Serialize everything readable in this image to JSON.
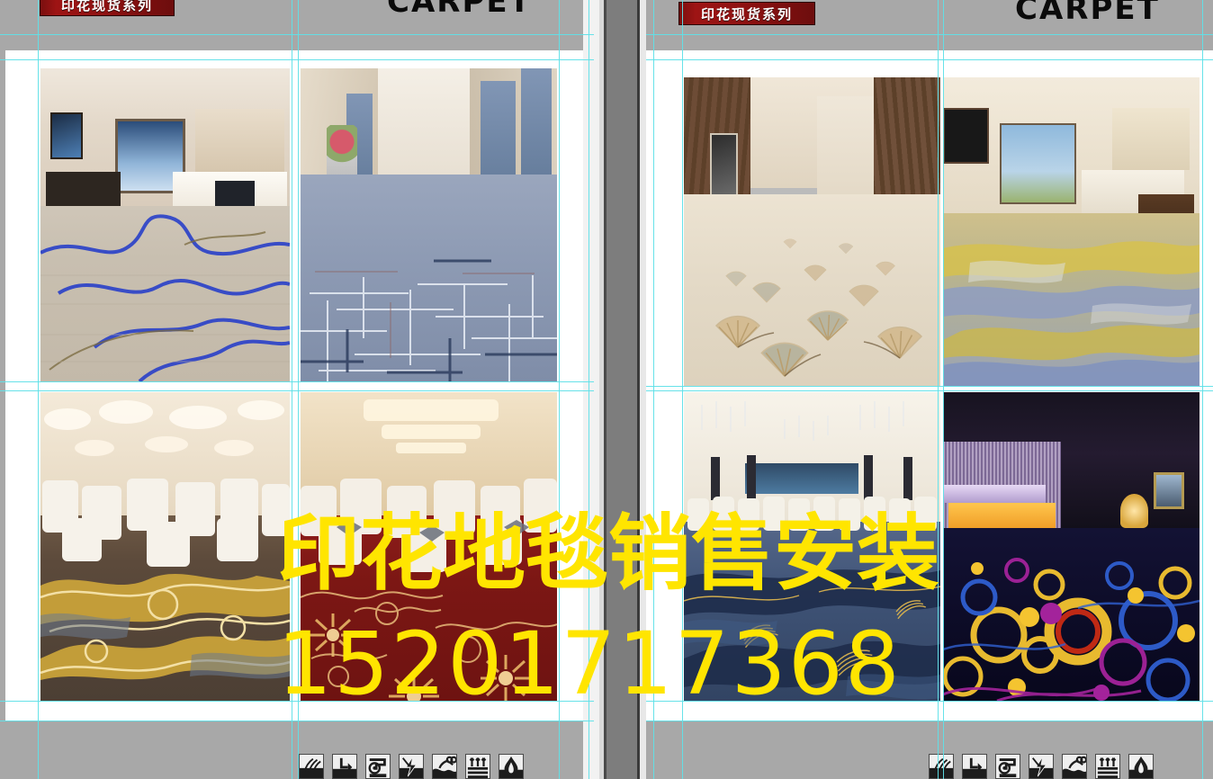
{
  "document": {
    "background_color": "#a8a8a8",
    "guide_color": "#5fe0e8",
    "page_color": "#ffffff",
    "spine_color": "#7d7d7d"
  },
  "watermark": {
    "line1": "印花地毯销售安装",
    "line2": "15201717368",
    "color": "#ffe500"
  },
  "pages": [
    {
      "id": "left",
      "banner": {
        "text": "印花现货系列",
        "bg_color": "#8d1111",
        "text_color": "#ffffff"
      },
      "wordmark": {
        "text": "CARPET",
        "color": "#0b0b0b"
      },
      "photos": [
        {
          "id": "p1",
          "caption": "hotel-bedroom-beige-blue-swirl-carpet"
        },
        {
          "id": "p2",
          "caption": "hotel-corridor-blue-grid-carpet"
        },
        {
          "id": "p3",
          "caption": "banquet-hall-gold-brown-swirl-carpet"
        },
        {
          "id": "p4",
          "caption": "banquet-hall-red-floral-carpet"
        }
      ],
      "icons": [
        {
          "name": "anti-static-icon",
          "label": "anti-static"
        },
        {
          "name": "water-drain-icon",
          "label": "water-drain"
        },
        {
          "name": "vacuum-clean-icon",
          "label": "vacuum-clean"
        },
        {
          "name": "electrical-safe-icon",
          "label": "electrical-safe"
        },
        {
          "name": "stain-resistant-icon",
          "label": "stain-resistant"
        },
        {
          "name": "underfloor-heat-icon",
          "label": "underfloor-heating"
        },
        {
          "name": "flame-retardant-icon",
          "label": "flame-retardant"
        }
      ]
    },
    {
      "id": "right",
      "banner": {
        "text": "印花现货系列",
        "bg_color": "#8d1111",
        "text_color": "#ffffff"
      },
      "wordmark": {
        "text": "CARPET",
        "color": "#0b0b0b"
      },
      "photos": [
        {
          "id": "p5",
          "caption": "hotel-corridor-ginkgo-leaf-carpet"
        },
        {
          "id": "p6",
          "caption": "hotel-bedroom-blue-yellow-abstract-carpet"
        },
        {
          "id": "p7",
          "caption": "banquet-hall-blue-gold-carpet"
        },
        {
          "id": "p8",
          "caption": "dark-lobby-colored-circles-carpet"
        }
      ],
      "icons": [
        {
          "name": "anti-static-icon",
          "label": "anti-static"
        },
        {
          "name": "water-drain-icon",
          "label": "water-drain"
        },
        {
          "name": "vacuum-clean-icon",
          "label": "vacuum-clean"
        },
        {
          "name": "electrical-safe-icon",
          "label": "electrical-safe"
        },
        {
          "name": "stain-resistant-icon",
          "label": "stain-resistant"
        },
        {
          "name": "underfloor-heat-icon",
          "label": "underfloor-heating"
        },
        {
          "name": "flame-retardant-icon",
          "label": "flame-retardant"
        }
      ]
    }
  ]
}
